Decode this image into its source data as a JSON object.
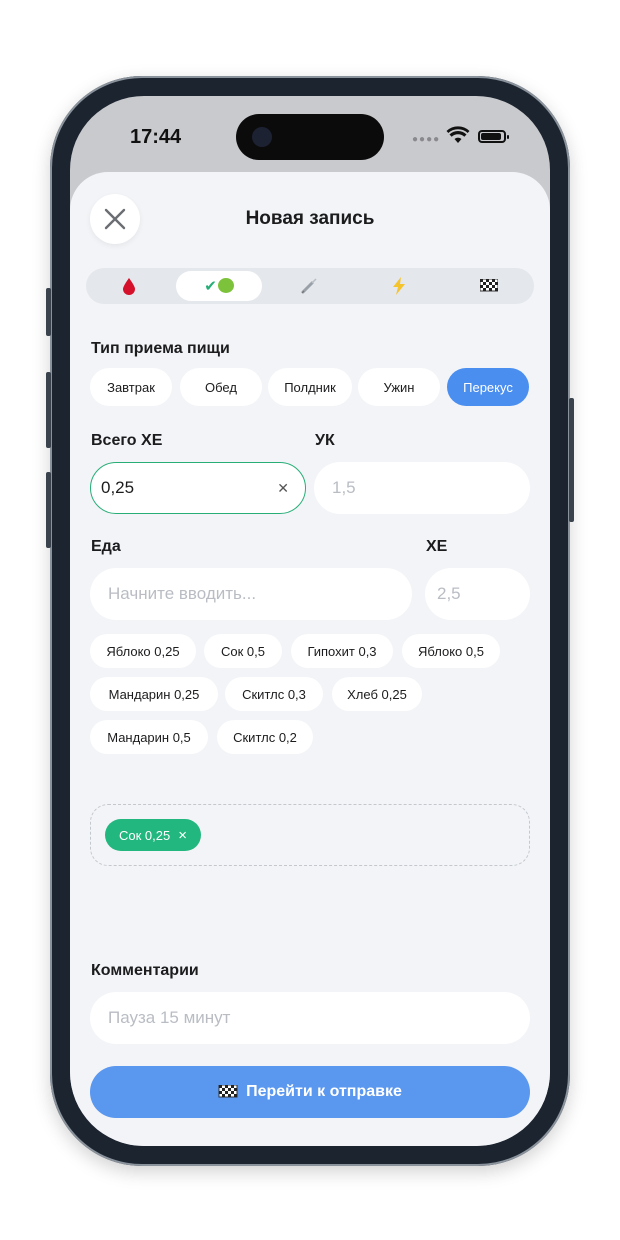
{
  "status_bar": {
    "time": "17:44"
  },
  "header": {
    "title": "Новая запись"
  },
  "tabs": [
    {
      "icon": "blood-drop-icon",
      "glyph": "🩸"
    },
    {
      "icon": "check-apple-icon",
      "glyph": "✔🍏"
    },
    {
      "icon": "syringe-icon",
      "glyph": "💉"
    },
    {
      "icon": "lightning-icon",
      "glyph": "⚡"
    },
    {
      "icon": "checkered-flag-icon",
      "glyph": "🏁"
    }
  ],
  "active_tab": 1,
  "meal_type": {
    "label": "Тип приема пищи",
    "options": [
      "Завтрак",
      "Обед",
      "Полдник",
      "Ужин",
      "Перекус"
    ],
    "selected": "Перекус"
  },
  "total_xe": {
    "label": "Всего ХЕ",
    "value": "0,25"
  },
  "uk": {
    "label": "УК",
    "placeholder": "1,5"
  },
  "food": {
    "label": "Еда",
    "placeholder": "Начните вводить..."
  },
  "xe": {
    "label": "ХЕ",
    "placeholder": "2,5"
  },
  "suggestions": [
    "Яблоко 0,25",
    "Сок 0,5",
    "Гипохит 0,3",
    "Яблоко 0,5",
    "Мандарин 0,25",
    "Скитлс 0,3",
    "Хлеб 0,25",
    "Мандарин 0,5",
    "Скитлс 0,2"
  ],
  "selected_food": {
    "label": "Сок 0,25",
    "remove": "×"
  },
  "comments": {
    "label": "Комментарии",
    "placeholder": "Пауза 15 минут"
  },
  "submit": {
    "icon": "🏁",
    "label": "Перейти к отправке"
  },
  "colors": {
    "accent_blue": "#4a8ef0",
    "accent_green": "#22b77e",
    "background": "#f2f4f7"
  }
}
